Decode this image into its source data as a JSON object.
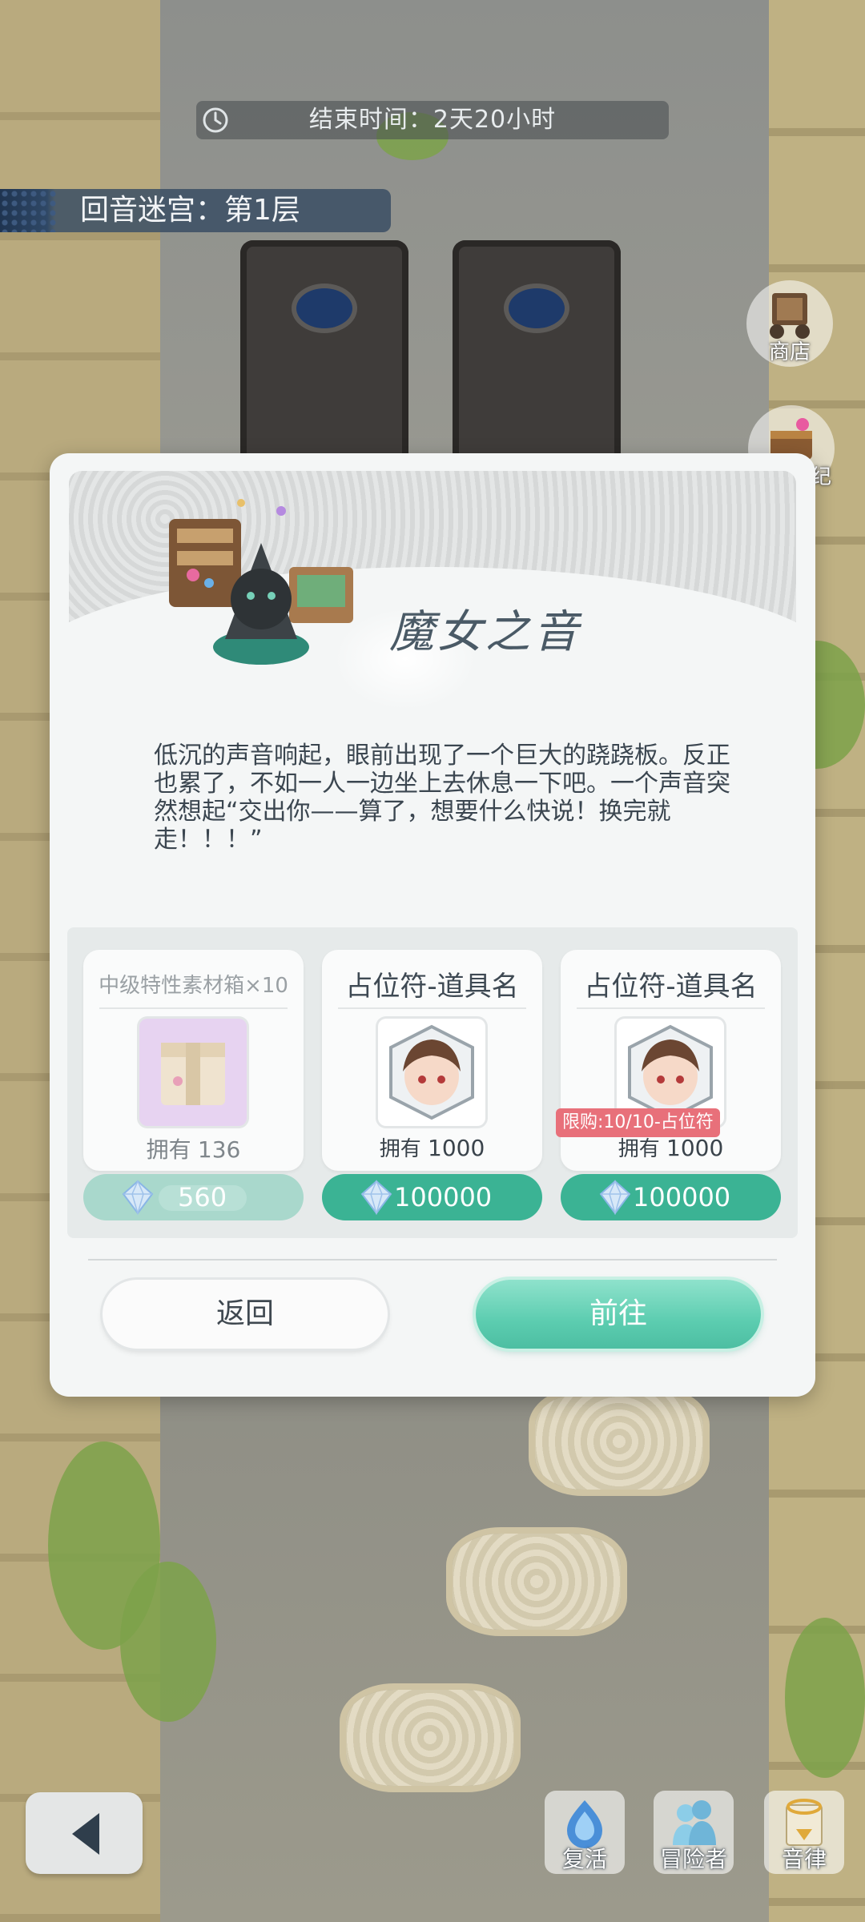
{
  "hud": {
    "timer_text": "结束时间：2天20小时",
    "floor_text": "回音迷宫：第1层"
  },
  "side_buttons": {
    "shop_label": "商店",
    "second_label": "纪"
  },
  "dialog": {
    "title": "魔女之音",
    "description": "低沉的声音响起，眼前出现了一个巨大的跷跷板。反正也累了，不如一人一边坐上去休息一下吧。一个声音突然想起“交出你——算了，想要什么快说！换完就走！！！”",
    "items": [
      {
        "name": "中级特性素材箱×10",
        "own_label": "拥有",
        "own_count": "136",
        "price": "560",
        "icon": "material-box-icon"
      },
      {
        "name": "占位符-道具名",
        "own_label": "拥有",
        "own_count": "1000",
        "price": "100000",
        "icon": "character-portrait-icon"
      },
      {
        "name": "占位符-道具名",
        "own_label": "拥有",
        "own_count": "1000",
        "price": "100000",
        "limit": "限购:10/10-占位符",
        "icon": "character-portrait-icon"
      }
    ],
    "back_label": "返回",
    "go_label": "前往"
  },
  "bottom_bar": {
    "revive_label": "复活",
    "adventurer_label": "冒险者",
    "melody_label": "音律"
  },
  "colors": {
    "accent": "#3bb394",
    "limit_badge": "#e8707a",
    "panel": "#f4f6f6"
  }
}
